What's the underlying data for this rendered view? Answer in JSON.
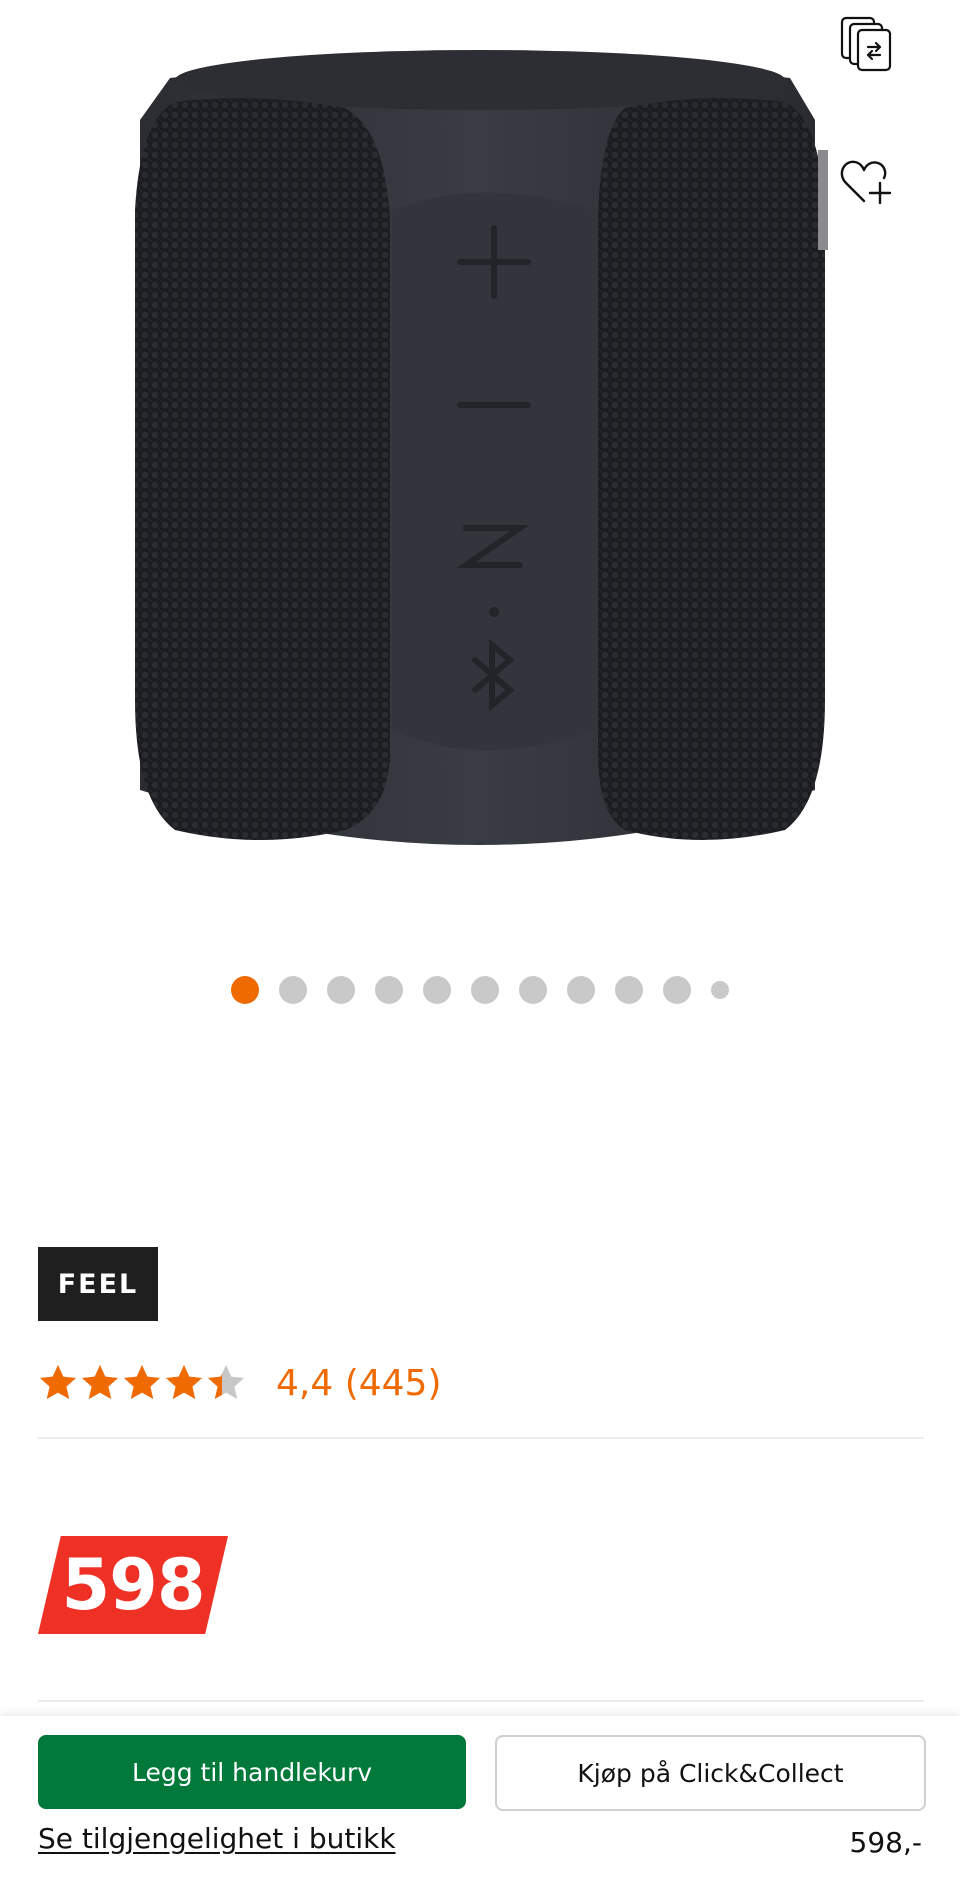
{
  "product": {
    "image_alt": "Feel bluetooth speaker",
    "carousel": {
      "total_dots": 11,
      "active_index": 0
    }
  },
  "actions": {
    "compare_icon": "compare-icon",
    "wishlist_icon": "heart-plus-icon"
  },
  "brand": {
    "logo_text": "FEEL"
  },
  "rating": {
    "stars": 4.4,
    "max_stars": 5,
    "text": "4,4 (445)"
  },
  "price": {
    "badge": "598"
  },
  "bottom_bar": {
    "add_to_cart_label": "Legg til handlekurv",
    "click_collect_label": "Kjøp på Click&Collect",
    "store_availability_label": "Se tilgjengelighet i butikk",
    "price_label": "598,-"
  },
  "colors": {
    "accent_orange": "#ef6a00",
    "price_red": "#ee3124",
    "primary_green": "#00793a",
    "dot_inactive": "#c9c9c9"
  }
}
